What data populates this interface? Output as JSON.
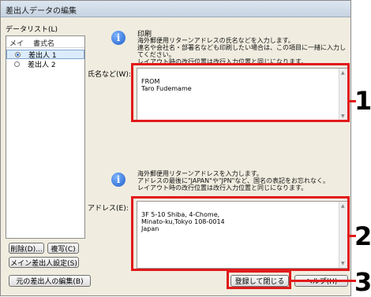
{
  "window": {
    "title": "差出人データの編集"
  },
  "list": {
    "group_label": "データリスト(L)",
    "columns": [
      "メイン",
      "書式名"
    ],
    "rows": [
      {
        "name": "差出人 1",
        "selected": true
      },
      {
        "name": "差出人 2",
        "selected": false
      }
    ]
  },
  "buttons": {
    "delete": "削除(D)...",
    "copy": "複写(C)",
    "set_main": "メイン差出人設定(S)",
    "edit_original": "元の差出人の編集(B)",
    "register_close": "登録して閉じる",
    "help": "ヘルプ(H)"
  },
  "name_section": {
    "heading": "印刷",
    "description": "海外郵便用リターンアドレスの氏名などを入力します。\n連名や会社名・部署名なども印刷したい場合は、この項目に一緒に入力してください。\nレイアウト時の改行位置は改行入力位置と同じになります。",
    "label": "氏名など(W):",
    "value": "FROM\nTaro Fudemame"
  },
  "address_section": {
    "description": "海外郵便用リターンアドレスを入力します。\nアドレスの最後に\"JAPAN\"や\"JPN\"など、国名の表記をお忘れなく。\nレイアウト時の改行位置は改行入力位置と同じになります。",
    "label": "アドレス(E):",
    "value": "3F 5-10 Shiba, 4-Chome,\nMinato-ku,Tokyo 108-0014\nJapan"
  },
  "callouts": [
    "1",
    "2",
    "3"
  ],
  "colors": {
    "callout": "#e11a1a",
    "dialog_bg": "#f0ede0"
  }
}
